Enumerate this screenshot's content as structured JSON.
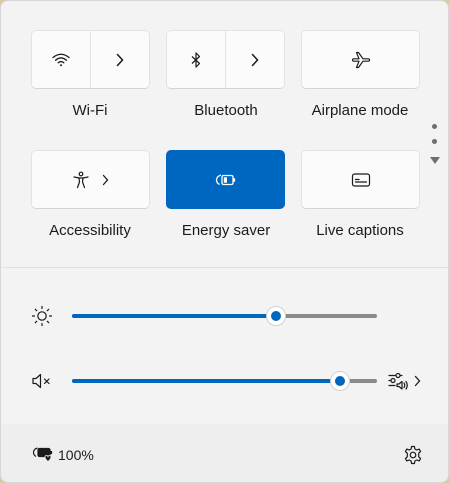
{
  "tiles": {
    "wifi": {
      "label": "Wi-Fi",
      "icon": "wifi-icon",
      "active": false
    },
    "bluetooth": {
      "label": "Bluetooth",
      "icon": "bluetooth-icon",
      "active": false
    },
    "airplane": {
      "label": "Airplane mode",
      "icon": "airplane-icon",
      "active": false
    },
    "accessibility": {
      "label": "Accessibility",
      "icon": "accessibility-icon",
      "active": false
    },
    "energy_saver": {
      "label": "Energy saver",
      "icon": "energy-saver-icon",
      "active": true
    },
    "live_captions": {
      "label": "Live captions",
      "icon": "captions-icon",
      "active": false
    }
  },
  "sliders": {
    "brightness": {
      "icon": "brightness-icon",
      "level": 0.67
    },
    "volume": {
      "icon": "volume-muted-icon",
      "level": 0.88
    }
  },
  "footer": {
    "battery_icon": "battery-charging-icon",
    "battery_text": "100%",
    "settings_icon": "gear-icon"
  },
  "colors": {
    "accent": "#0067c0",
    "panel_bg": "#f3f3f3",
    "tile_bg": "#fbfbfb"
  }
}
